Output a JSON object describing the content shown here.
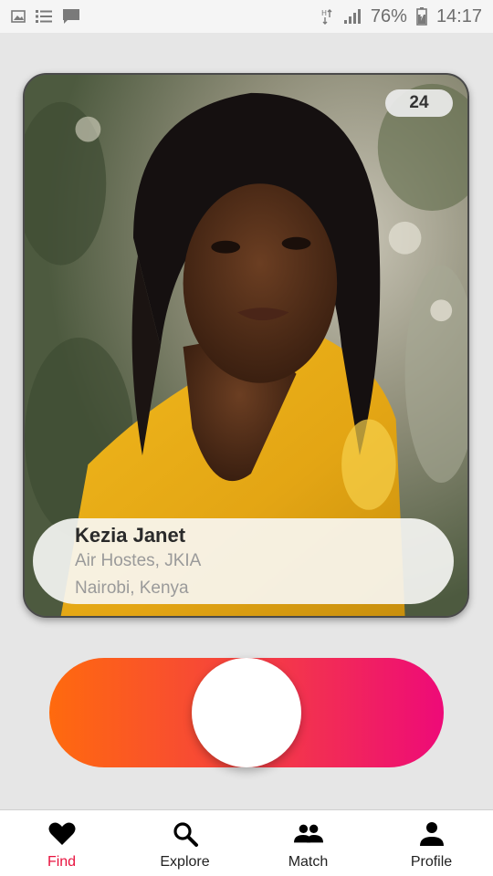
{
  "status_bar": {
    "battery": "76%",
    "time": "14:17",
    "left_icons": [
      "image-icon",
      "list-icon",
      "message-icon"
    ],
    "right_icons": [
      "data-arrows-icon",
      "signal-icon",
      "battery-charging-icon"
    ]
  },
  "card": {
    "age": "24",
    "name": "Kezia Janet",
    "occupation": "Air Hostes, JKIA",
    "location": "Nairobi, Kenya"
  },
  "slider": {
    "position": 0.5,
    "gradient_start": "#ff6a0e",
    "gradient_end": "#ee0a78"
  },
  "nav": {
    "active_color": "#e8123e",
    "items": [
      {
        "label": "Find",
        "icon": "heart-icon",
        "active": true
      },
      {
        "label": "Explore",
        "icon": "search-icon",
        "active": false
      },
      {
        "label": "Match",
        "icon": "people-icon",
        "active": false
      },
      {
        "label": "Profile",
        "icon": "person-icon",
        "active": false
      }
    ]
  }
}
